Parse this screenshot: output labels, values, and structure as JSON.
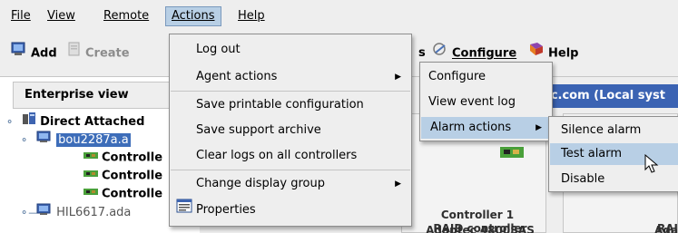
{
  "menubar": {
    "file": "File",
    "view": "View",
    "remote": "Remote",
    "actions": "Actions",
    "help": "Help"
  },
  "toolbar": {
    "add": "Add",
    "create": "Create",
    "partial_s": "s",
    "configure": "Configure",
    "help": "Help"
  },
  "left_pane": {
    "header": "Enterprise view",
    "tree": [
      {
        "label": "Direct Attached"
      },
      {
        "label": "bou2287a.a"
      },
      {
        "label": "Controlle"
      },
      {
        "label": "Controlle"
      },
      {
        "label": "Controlle"
      },
      {
        "label": "HIL6617.ada"
      }
    ]
  },
  "right_pane": {
    "system_bar": "ec.com (Local syst",
    "controller": {
      "name": "Controller 1",
      "type": "RAID controller",
      "model": "Adaptec 4800SAS"
    },
    "second_card": {
      "type": "RAI",
      "model": "Ada"
    }
  },
  "actions_menu": {
    "log_out": "Log out",
    "agent_actions": "Agent actions",
    "save_printable": "Save printable configuration",
    "save_support": "Save support archive",
    "clear_logs": "Clear logs on all controllers",
    "change_display_group": "Change display group",
    "properties": "Properties"
  },
  "agent_menu": {
    "configure": "Configure",
    "view_event_log": "View event log",
    "alarm_actions": "Alarm actions"
  },
  "alarm_menu": {
    "silence": "Silence alarm",
    "test": "Test alarm",
    "disable": "Disable"
  },
  "colors": {
    "menu_highlight": "#b8cfe5",
    "selection_blue": "#3d6db9",
    "system_bar": "#3b63b3"
  }
}
